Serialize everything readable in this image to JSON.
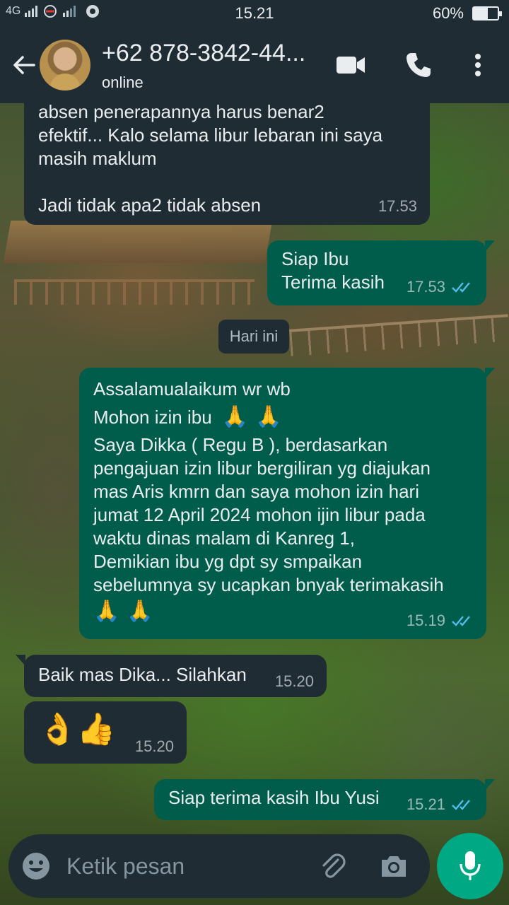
{
  "status_bar": {
    "network_left": "4G",
    "time": "15.21",
    "battery_percent": "60%",
    "battery_level": 0.6
  },
  "header": {
    "contact_name": "+62 878-3842-44...",
    "contact_status": "online",
    "icons": [
      "back-arrow-icon",
      "avatar",
      "video-call-icon",
      "phone-icon",
      "more-vert-icon"
    ]
  },
  "messages": [
    {
      "direction": "in",
      "text": "absen penerapannya  harus benar2\nefektif... Kalo selama libur lebaran ini saya\nmasih maklum\n\nJadi tidak apa2 tidak absen",
      "time": "17.53"
    },
    {
      "direction": "out",
      "text": "Siap Ibu\nTerima kasih",
      "time": "17.53",
      "read": true
    },
    {
      "direction": "out",
      "line1": "Assalamualaikum wr wb",
      "line2": "Mohon izin ibu",
      "body": "Saya Dikka ( Regu B ), berdasarkan\npengajuan izin libur bergiliran yg diajukan\nmas Aris kmrn dan saya  mohon izin hari\njumat 12 April 2024 mohon ijin libur pada\nwaktu dinas malam di Kanreg 1,\nDemikian ibu yg dpt sy smpaikan\nsebelumnya sy ucapkan bnyak terimakasih",
      "time": "15.19",
      "read": true
    },
    {
      "direction": "in",
      "text": "Baik mas Dika... Silahkan",
      "time": "15.20"
    },
    {
      "direction": "in",
      "text": "👌👍",
      "time": "15.20"
    },
    {
      "direction": "out",
      "text": "Siap terima kasih Ibu Yusi",
      "time": "15.21",
      "read": true
    }
  ],
  "date_divider": "Hari ini",
  "composer": {
    "placeholder": "Ketik pesan"
  },
  "colors": {
    "header_bg": "#1f2c34",
    "incoming_bubble": "#1f2c34",
    "outgoing_bubble": "#005c4b",
    "accent": "#00a884",
    "read_ticks": "#53bdeb"
  }
}
